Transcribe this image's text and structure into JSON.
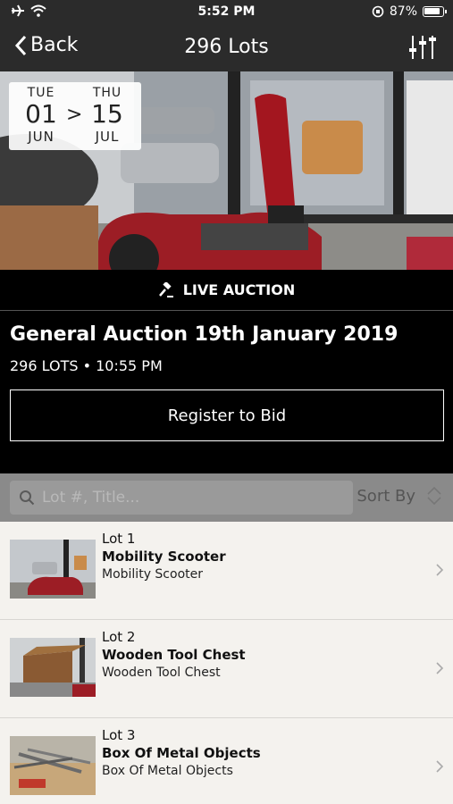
{
  "status": {
    "time": "5:52 PM",
    "battery": "87%"
  },
  "nav": {
    "back_label": "Back",
    "title": "296 Lots"
  },
  "dates": {
    "start": {
      "dow": "TUE",
      "day": "01",
      "month": "JUN"
    },
    "end": {
      "dow": "THU",
      "day": "15",
      "month": "JUL"
    },
    "arrow": ">"
  },
  "live": {
    "label": "LIVE AUCTION"
  },
  "auction": {
    "title": "General Auction 19th January 2019",
    "meta": "296 LOTS • 10:55 PM",
    "register_label": "Register to Bid"
  },
  "search": {
    "placeholder": "Lot #, Title...",
    "sort_label": "Sort By"
  },
  "lots": [
    {
      "number": "Lot 1",
      "title": "Mobility Scooter",
      "subtitle": "Mobility Scooter"
    },
    {
      "number": "Lot 2",
      "title": "Wooden Tool Chest",
      "subtitle": "Wooden Tool Chest"
    },
    {
      "number": "Lot 3",
      "title": "Box Of Metal Objects",
      "subtitle": "Box Of Metal Objects"
    }
  ],
  "colors": {
    "bar": "#2b2b2b",
    "banner": "#000000",
    "list_bg": "#f4f2ee",
    "search_bg": "#8a8a8a"
  }
}
